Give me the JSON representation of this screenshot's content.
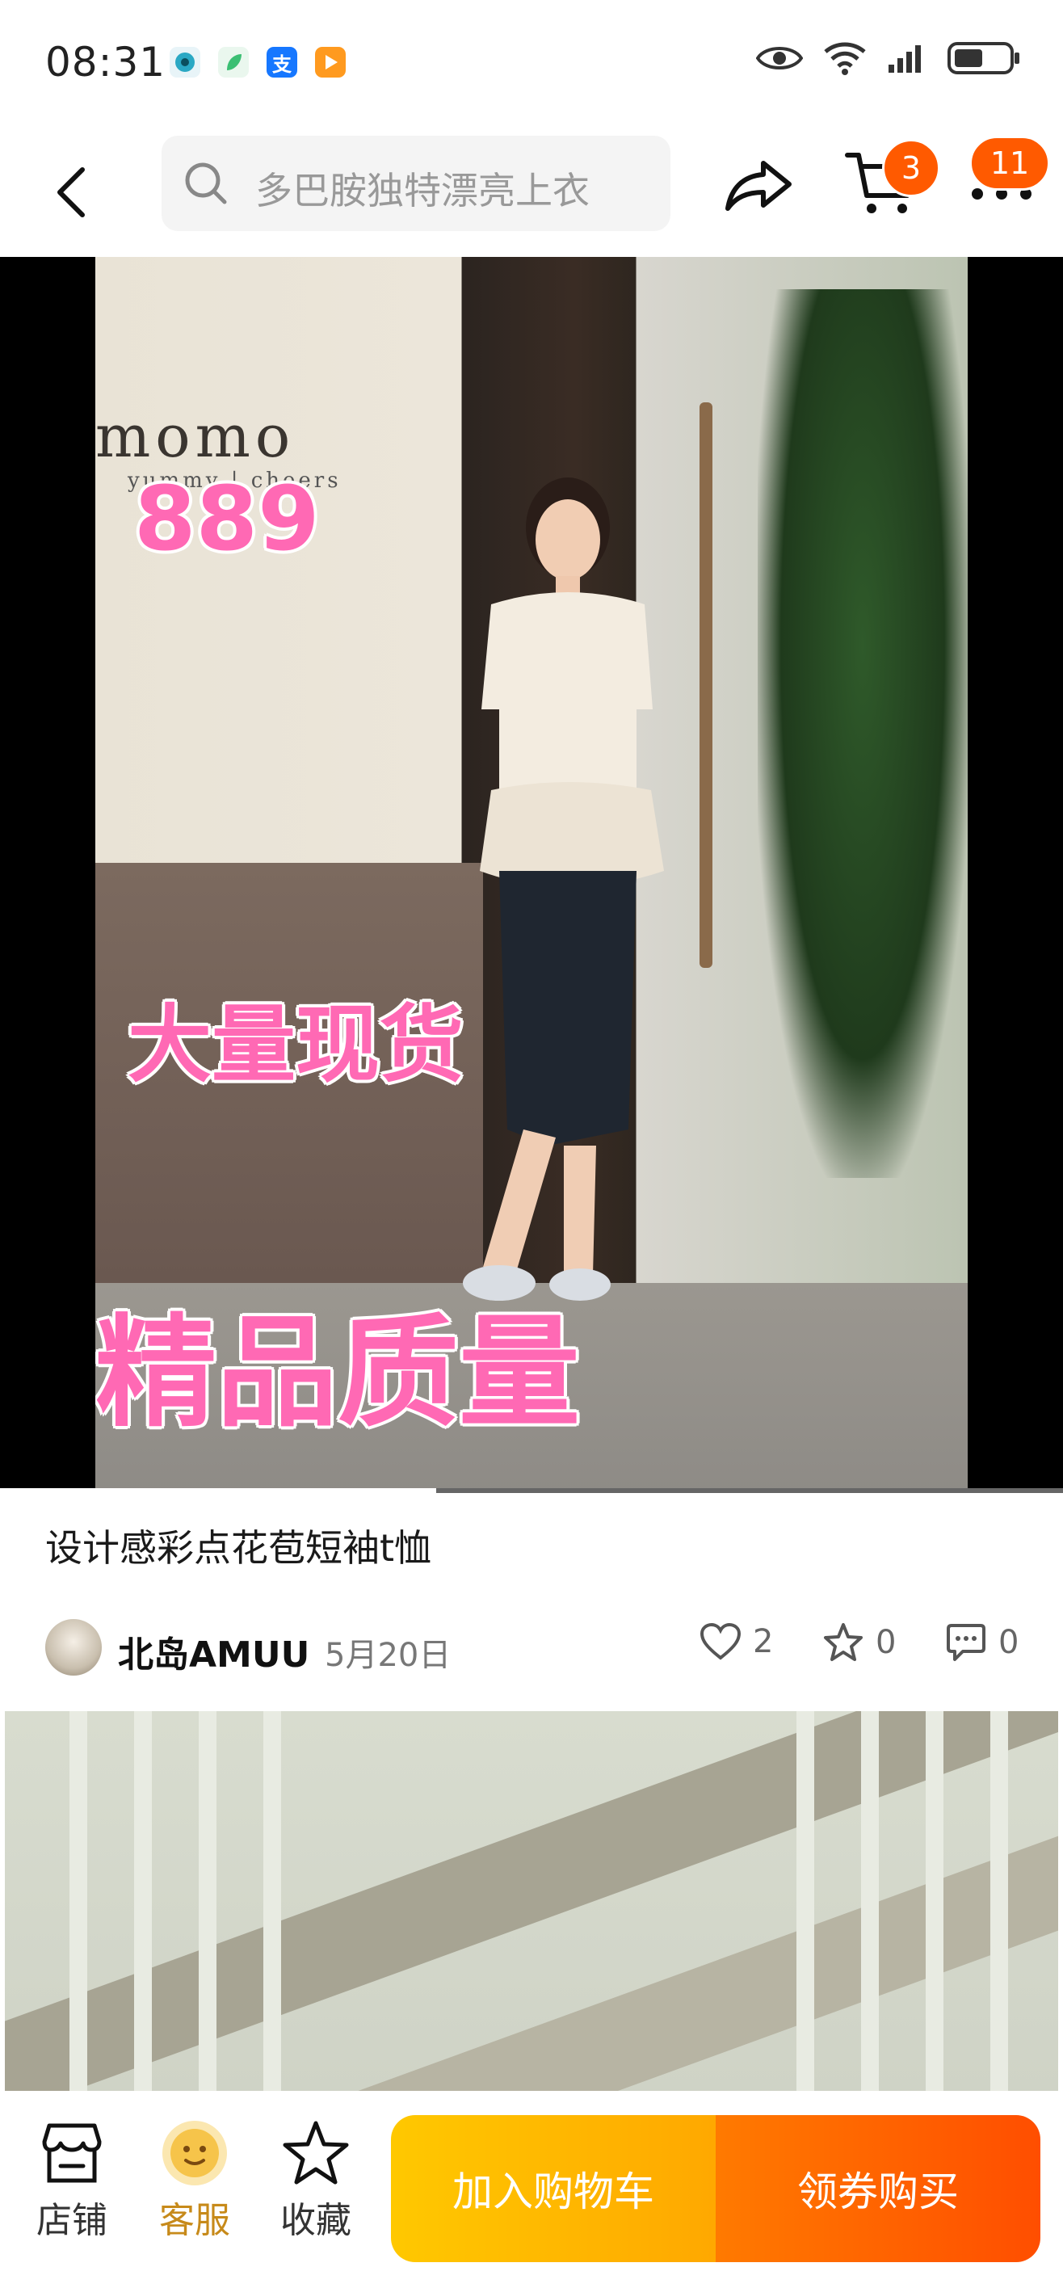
{
  "status_bar": {
    "time": "08:31",
    "app_icons": [
      "camera-app-icon",
      "leaf-app-icon",
      "alipay-app-icon",
      "video-app-icon"
    ],
    "right_icons": [
      "eye-icon",
      "wifi-icon",
      "signal-icon",
      "battery-icon"
    ]
  },
  "nav": {
    "search_placeholder": "多巴胺独特漂亮上衣",
    "cart_badge": "3",
    "more_badge": "11"
  },
  "video": {
    "sign_text": "momo",
    "sign_sub": "yummy | cheers",
    "overlay_number": "889",
    "overlay_stock": "大量现货",
    "overlay_quality": "精品质量",
    "progress": 0.41
  },
  "post": {
    "title": "设计感彩点花苞短袖t恤",
    "author": "北岛AMUU",
    "date": "5月20日",
    "likes": "2",
    "favorites": "0",
    "comments": "0"
  },
  "bottom_bar": {
    "store_label": "店铺",
    "service_label": "客服",
    "favorite_label": "收藏",
    "add_to_cart_label": "加入购物车",
    "buy_label": "领券购买"
  },
  "colors": {
    "accent_orange": "#ff5a00",
    "cart_button": "#ffb800",
    "buy_button": "#ff5a00",
    "overlay_pink": "#ff69b4"
  }
}
